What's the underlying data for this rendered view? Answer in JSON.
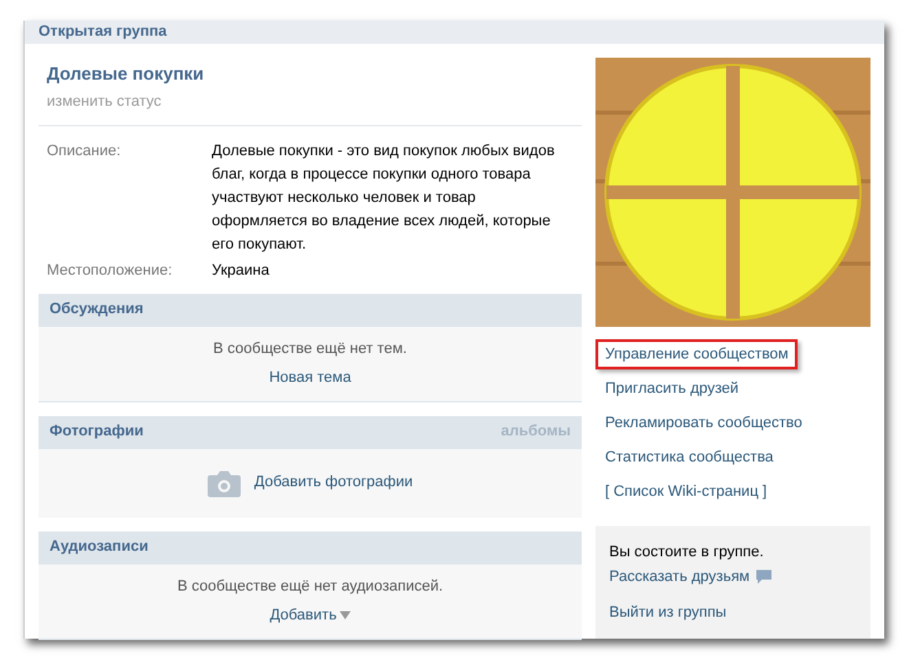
{
  "header": {
    "title": "Открытая группа"
  },
  "group": {
    "name": "Долевые покупки",
    "status_link": "изменить статус"
  },
  "info": [
    {
      "label": "Описание:",
      "value": "Долевые покупки - это вид покупок любых видов благ, когда в процессе покупки одного товара участвуют несколько человек и товар оформляется во владение всех людей, которые его покупают."
    },
    {
      "label": "Местоположение:",
      "value": "Украина"
    }
  ],
  "sections": [
    {
      "kind": "text",
      "title": "Обсуждения",
      "empty_text": "В сообществе ещё нет тем.",
      "action": "Новая тема"
    },
    {
      "kind": "photo",
      "title": "Фотографии",
      "header_link": "альбомы",
      "action": "Добавить фотографии"
    },
    {
      "kind": "dropdown",
      "title": "Аудиозаписи",
      "empty_text": "В сообществе ещё нет аудиозаписей.",
      "action": "Добавить"
    }
  ],
  "actions": [
    {
      "label": "Управление сообществом",
      "highlighted": true
    },
    {
      "label": "Пригласить друзей",
      "highlighted": false
    },
    {
      "label": "Рекламировать сообщество",
      "highlighted": false
    },
    {
      "label": "Статистика сообщества",
      "highlighted": false
    },
    {
      "label": "[ Список Wiki-страниц ]",
      "highlighted": false
    }
  ],
  "membership": {
    "text": "Вы состоите в группе.",
    "share": "Рассказать друзьям",
    "leave": "Выйти из группы"
  }
}
